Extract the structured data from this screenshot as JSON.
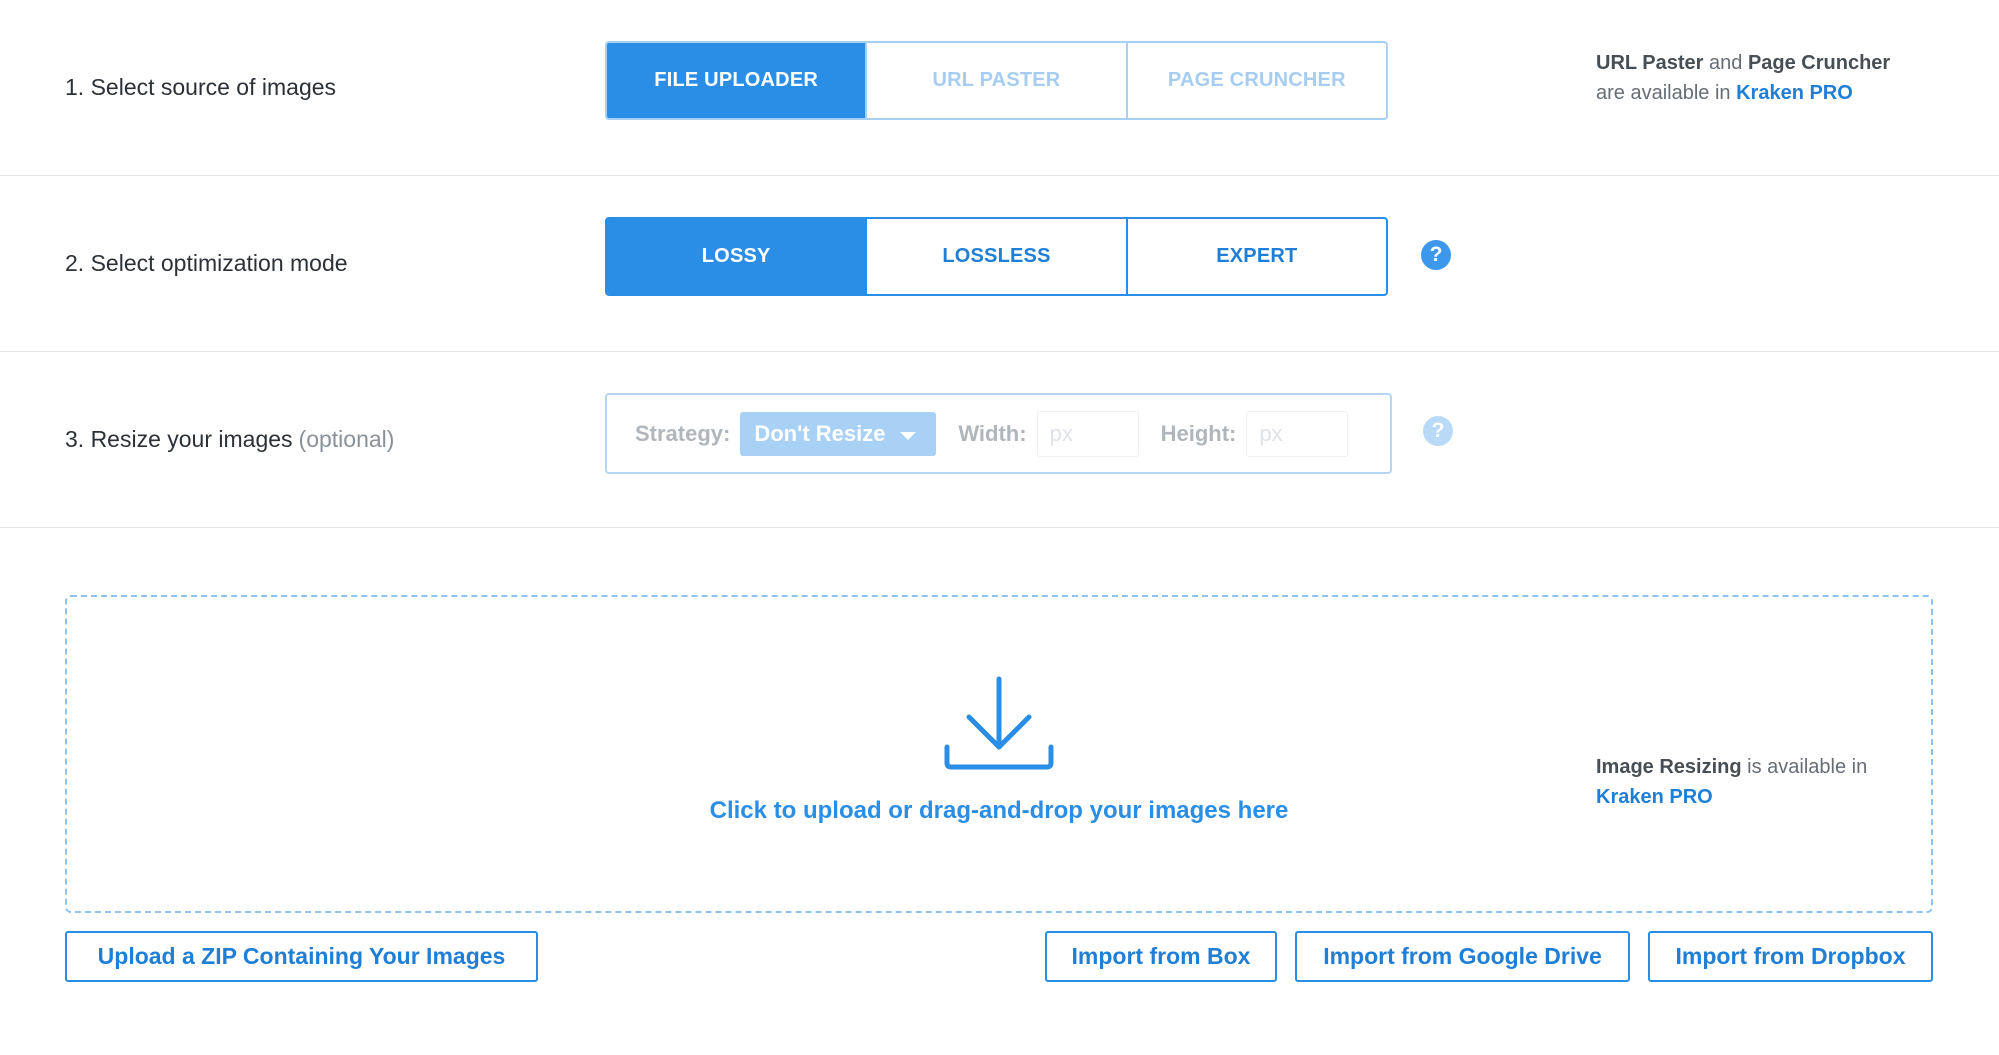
{
  "step1": {
    "label": "1. Select source of images",
    "options": [
      "FILE UPLOADER",
      "URL PASTER",
      "PAGE CRUNCHER"
    ],
    "active": "FILE UPLOADER",
    "note": {
      "bold1": "URL Paster",
      "text1": " and ",
      "bold2": "Page Cruncher",
      "text2": "are available in ",
      "link": "Kraken PRO"
    }
  },
  "step2": {
    "label": "2. Select optimization mode",
    "options": [
      "LOSSY",
      "LOSSLESS",
      "EXPERT"
    ],
    "active": "LOSSY",
    "help_icon": "question-circle-icon",
    "help_glyph": "?"
  },
  "step3": {
    "label": "3. Resize your images",
    "optional": "(optional)",
    "strategy_label": "Strategy:",
    "strategy_value": "Don't Resize",
    "width_label": "Width:",
    "width_placeholder": "px",
    "height_label": "Height:",
    "height_placeholder": "px",
    "help_icon": "question-circle-icon",
    "help_glyph": "?",
    "note": {
      "bold1": "Image Resizing",
      "text1": " is available in",
      "link": "Kraken PRO"
    }
  },
  "dropzone": {
    "icon": "download-icon",
    "text": "Click to upload or drag-and-drop your images here"
  },
  "buttons": {
    "zip": "Upload a ZIP Containing Your Images",
    "box": "Import from Box",
    "gdrive": "Import from Google Drive",
    "dropbox": "Import from Dropbox"
  },
  "colors": {
    "accent": "#2a8ee6",
    "disabled_accent": "#a9cff3",
    "text": "#2c3138",
    "muted": "#8a9199"
  }
}
